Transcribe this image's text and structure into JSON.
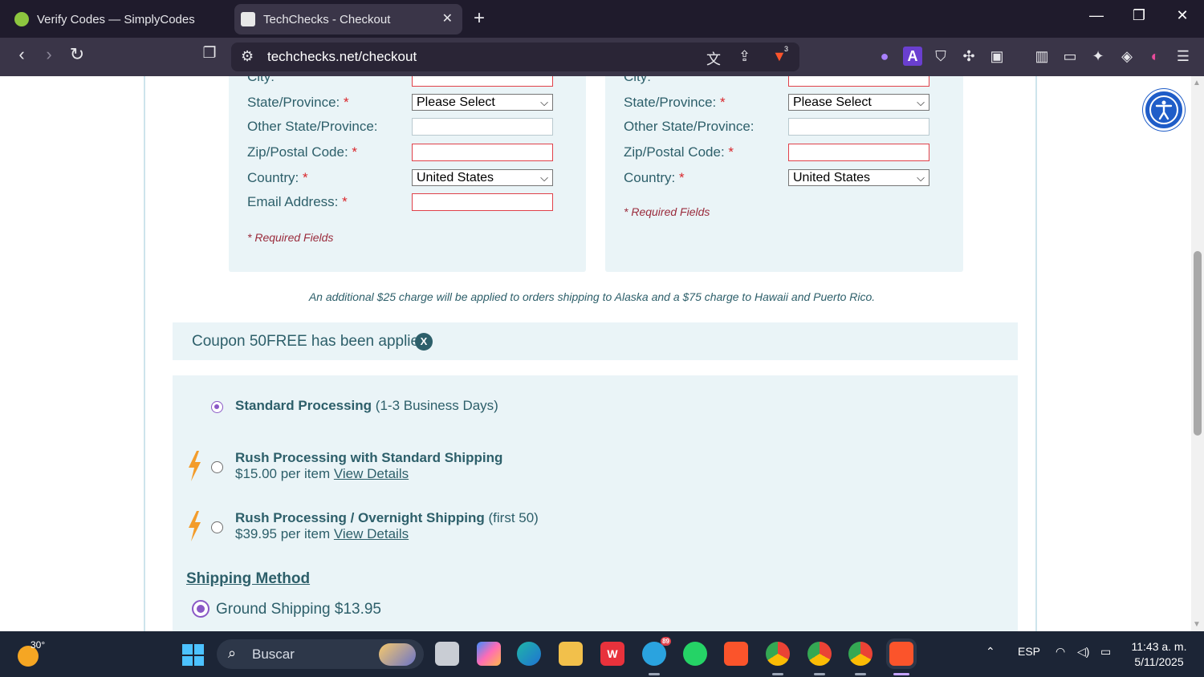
{
  "browser": {
    "tabs": [
      {
        "title": "Verify Codes — SimplyCodes",
        "active": false
      },
      {
        "title": "TechChecks - Checkout",
        "active": true
      }
    ],
    "new_tab_icon": "plus-icon",
    "url": "techchecks.net/checkout",
    "brave_badge": "3"
  },
  "billing": {
    "city_label": "City:",
    "state_label": "State/Province:",
    "state_value": "Please Select",
    "other_state_label": "Other State/Province:",
    "zip_label": "Zip/Postal Code:",
    "country_label": "Country:",
    "country_value": "United States",
    "email_label": "Email Address:",
    "required_note": "* Required Fields"
  },
  "shipping_address": {
    "city_label": "City:",
    "state_label": "State/Province:",
    "state_value": "Please Select",
    "other_state_label": "Other State/Province:",
    "zip_label": "Zip/Postal Code:",
    "country_label": "Country:",
    "country_value": "United States",
    "required_note": "* Required Fields"
  },
  "required_mark": "*",
  "notice": "An additional $25 charge will be applied to orders shipping to Alaska and a $75 charge to Hawaii and Puerto Rico.",
  "coupon": {
    "text": "Coupon 50FREE has been applied",
    "remove_label": "X"
  },
  "processing": [
    {
      "title": "Standard Processing",
      "detail": "(1-3 Business Days)",
      "price": "",
      "link": "",
      "selected": true
    },
    {
      "title": "Rush Processing with Standard Shipping",
      "detail": "",
      "price": "$15.00 per item",
      "link": "View Details",
      "selected": false
    },
    {
      "title": "Rush Processing / Overnight Shipping",
      "detail": "(first 50)",
      "price": "$39.95 per item",
      "link": "View Details",
      "selected": false
    }
  ],
  "shipping_method": {
    "heading": "Shipping Method",
    "options": [
      {
        "label": "Ground Shipping $13.95",
        "selected": true
      }
    ]
  },
  "taskbar": {
    "weather_temp": "30°",
    "search_placeholder": "Buscar",
    "telegram_badge": "89",
    "language": "ESP",
    "time": "11:43 a. m.",
    "date": "5/11/2025"
  },
  "colors": {
    "accent_teal": "#2d5f6a",
    "panel_bg": "#eaf4f7",
    "required_red": "#d9262b",
    "radio_purple": "#8a58c6",
    "bolt_orange": "#f39c2b"
  }
}
